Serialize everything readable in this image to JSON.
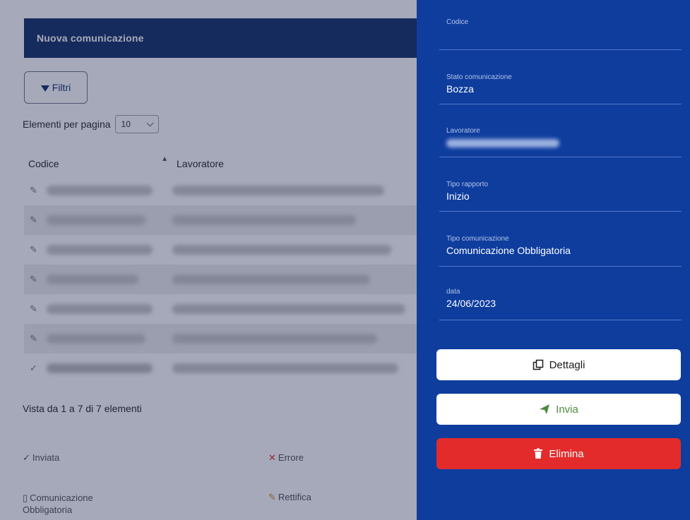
{
  "background_page": {
    "title": "Nuova comunicazione",
    "filter_button_label": "Filtri",
    "per_page_label": "Elementi per pagina",
    "per_page_value": "10",
    "table": {
      "headers": [
        "Codice",
        "Lavoratore"
      ],
      "rows": [
        {
          "status_icon": "pencil"
        },
        {
          "status_icon": "pencil"
        },
        {
          "status_icon": "pencil"
        },
        {
          "status_icon": "pencil"
        },
        {
          "status_icon": "pencil"
        },
        {
          "status_icon": "pencil"
        },
        {
          "status_icon": "check"
        }
      ]
    },
    "pagination_info": "Vista da 1 a 7 di 7 elementi",
    "legend": {
      "sent": "Inviata",
      "error": "Errore",
      "mandatory": "Comunicazione Obbligatoria",
      "rectify": "Rettifica"
    }
  },
  "detail_panel": {
    "fields": [
      {
        "label": "Codice",
        "value": ""
      },
      {
        "label": "Stato comunicazione",
        "value": "Bozza"
      },
      {
        "label": "Lavoratore",
        "value": ""
      },
      {
        "label": "Tipo rapporto",
        "value": "Inizio"
      },
      {
        "label": "Tipo comunicazione",
        "value": "Comunicazione Obbligatoria"
      },
      {
        "label": "data",
        "value": "24/06/2023"
      }
    ],
    "buttons": {
      "details": "Dettagli",
      "send": "Invia",
      "delete": "Elimina"
    }
  },
  "colors": {
    "panel_bg": "#0e3d9e",
    "header_bg": "#17356b",
    "delete_red": "#e32b2b",
    "send_green": "#4c8a3f"
  },
  "icons": {
    "filter": "funnel-icon",
    "details": "copy-icon",
    "send": "send-icon",
    "delete": "trash-icon"
  }
}
